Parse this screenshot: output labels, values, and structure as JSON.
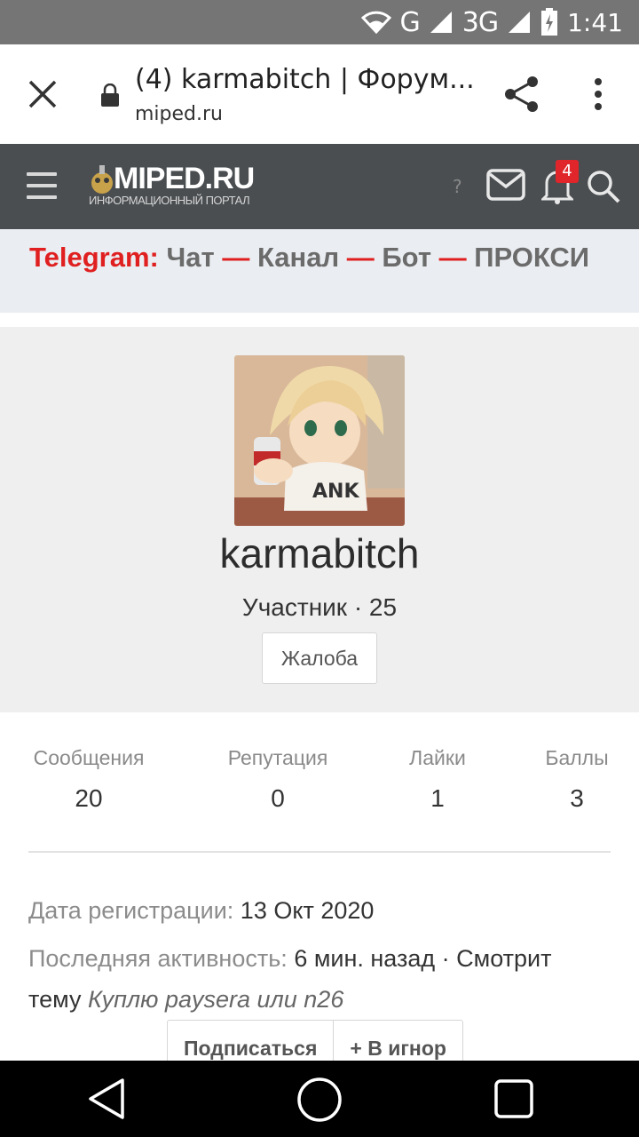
{
  "status_bar": {
    "network_g": "G",
    "network_3g": "3G",
    "time": "1:41"
  },
  "browser": {
    "title": "(4) karmabitch | Форум...",
    "url": "miped.ru"
  },
  "site": {
    "logo_name": "MIPED.RU",
    "logo_subtitle": "ИНФОРМАЦИОННЫЙ ПОРТАЛ",
    "help_mark": "?",
    "alerts_count": "4"
  },
  "telegram": {
    "label": "Telegram:",
    "links": [
      "Чат",
      "Канал",
      "Бот",
      "ПРОКСИ"
    ],
    "separator": " — "
  },
  "profile": {
    "username": "karmabitch",
    "role": "Участник · 25",
    "report_label": "Жалоба"
  },
  "stats": [
    {
      "label": "Сообщения",
      "value": "20"
    },
    {
      "label": "Репутация",
      "value": "0"
    },
    {
      "label": "Лайки",
      "value": "1"
    },
    {
      "label": "Баллы",
      "value": "3"
    }
  ],
  "info": {
    "reg_label": "Дата регистрации:",
    "reg_value": "13 Окт 2020",
    "activity_label": "Последняя активность:",
    "activity_value": "6 мин. назад · Смотрит",
    "activity_cont": "тему",
    "thread_title": "Куплю paysera или n26"
  },
  "actions": {
    "follow": "Подписаться",
    "ignore": "+ В игнор"
  },
  "colors": {
    "accent_red": "#e02020",
    "site_header": "#4a4e51",
    "profile_bg": "#efefef"
  }
}
